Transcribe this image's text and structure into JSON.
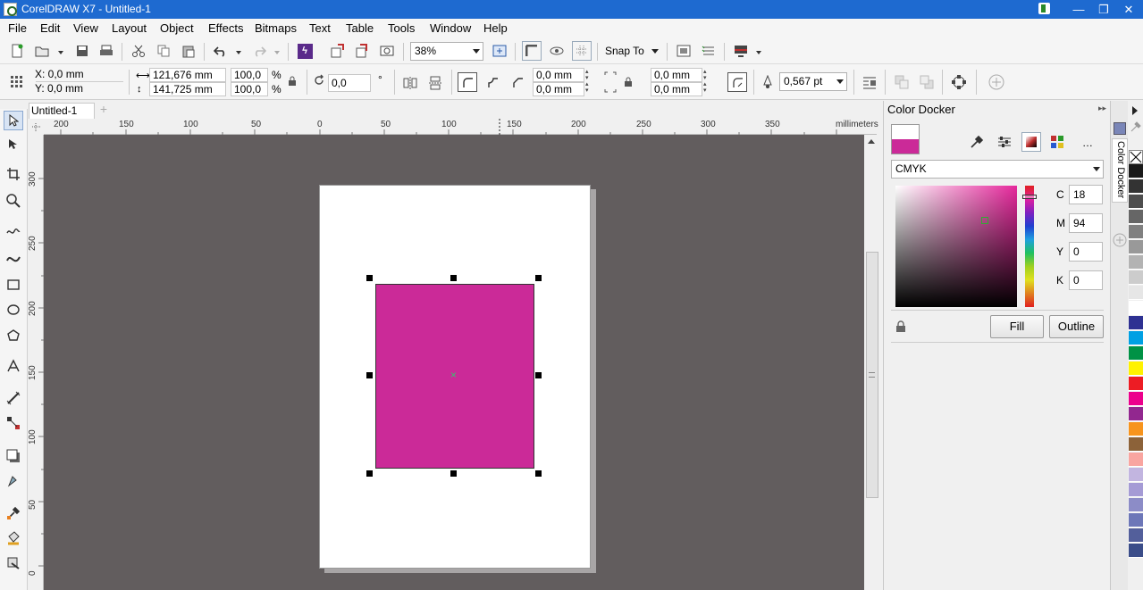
{
  "titlebar": {
    "title": "CorelDRAW X7 - Untitled-1"
  },
  "menu": [
    "File",
    "Edit",
    "View",
    "Layout",
    "Object",
    "Effects",
    "Bitmaps",
    "Text",
    "Table",
    "Tools",
    "Window",
    "Help"
  ],
  "toolbar": {
    "zoom": "38%",
    "snap": "Snap To"
  },
  "props": {
    "x": "X: 0,0 mm",
    "y": "Y: 0,0 mm",
    "w": "121,676 mm",
    "h": "141,725 mm",
    "sx": "100,0",
    "sy": "100,0",
    "pct1": "%",
    "pct2": "%",
    "rot": "0,0",
    "deg": "°",
    "c1": "0,0 mm",
    "c2": "0,0 mm",
    "c3": "0,0 mm",
    "c4": "0,0 mm",
    "outline": "0,567 pt"
  },
  "tab": {
    "label": "Untitled-1"
  },
  "hruler": {
    "ticks": [
      "200",
      "150",
      "100",
      "50",
      "0",
      "50",
      "100",
      "150",
      "200",
      "250",
      "300",
      "350"
    ],
    "unit": "millimeters"
  },
  "vruler": {
    "ticks": [
      "300",
      "250",
      "200",
      "150",
      "100",
      "50",
      "0"
    ]
  },
  "docker": {
    "title": "Color Docker",
    "model": "CMYK",
    "c_label": "C",
    "c": "18",
    "m_label": "M",
    "m": "94",
    "y_label": "Y",
    "y": "0",
    "k_label": "K",
    "k": "0",
    "fill": "Fill",
    "outline": "Outline",
    "tab": "Color Docker"
  },
  "colors": {
    "fill": "#cb2a98",
    "canvas": "#625d5e",
    "title": "#1e6ad0"
  },
  "palette": [
    "#1a1a1a",
    "#333333",
    "#4d4d4d",
    "#666666",
    "#808080",
    "#999999",
    "#b3b3b3",
    "#cccccc",
    "#e6e6e6",
    "#ffffff",
    "#2e3192",
    "#00a0e3",
    "#009245",
    "#fff200",
    "#ed1c24",
    "#ec008c",
    "#92278f",
    "#f7941d",
    "#8c6239",
    "#f9a5a0",
    "#c2b5e0",
    "#a59bd5",
    "#8c8cc7",
    "#6d77b8",
    "#535f9b",
    "#3b4d89"
  ]
}
